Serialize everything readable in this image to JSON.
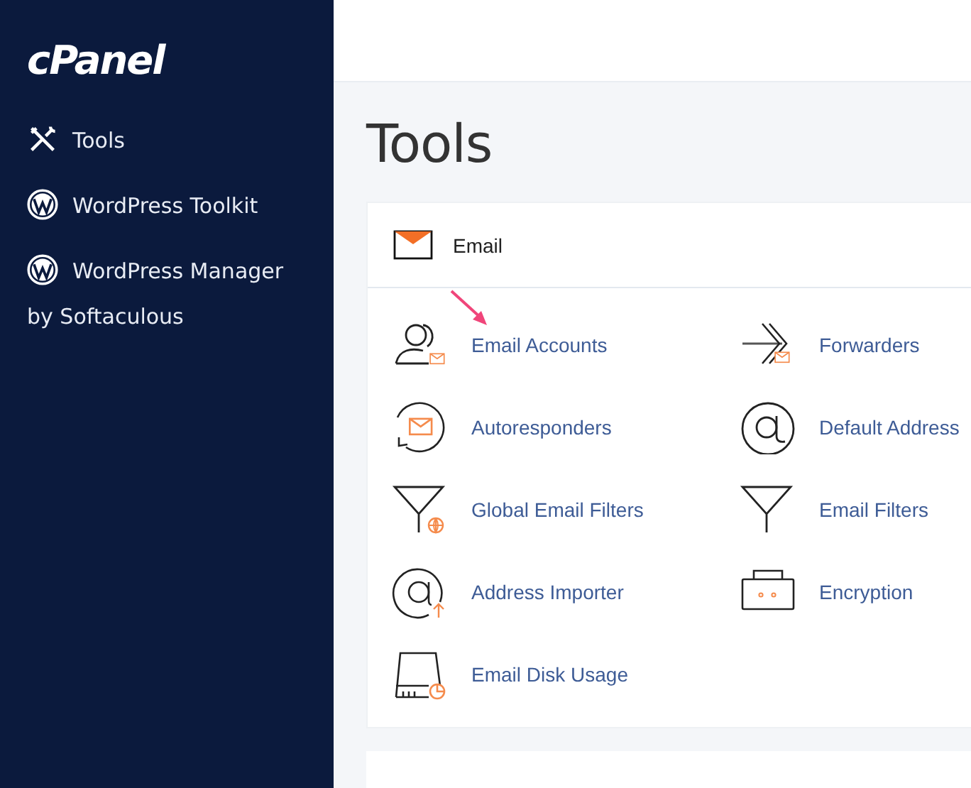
{
  "sidebar": {
    "logo": "cPanel",
    "items": [
      {
        "label": "Tools"
      },
      {
        "label": "WordPress Toolkit"
      },
      {
        "label": "WordPress Manager by Softaculous"
      }
    ]
  },
  "page": {
    "title": "Tools"
  },
  "section": {
    "title": "Email",
    "tools": [
      {
        "label": "Email Accounts"
      },
      {
        "label": "Forwarders"
      },
      {
        "label": "Autoresponders"
      },
      {
        "label": "Default Address"
      },
      {
        "label": "Global Email Filters"
      },
      {
        "label": "Email Filters"
      },
      {
        "label": "Address Importer"
      },
      {
        "label": "Encryption"
      },
      {
        "label": "Email Disk Usage"
      }
    ]
  }
}
